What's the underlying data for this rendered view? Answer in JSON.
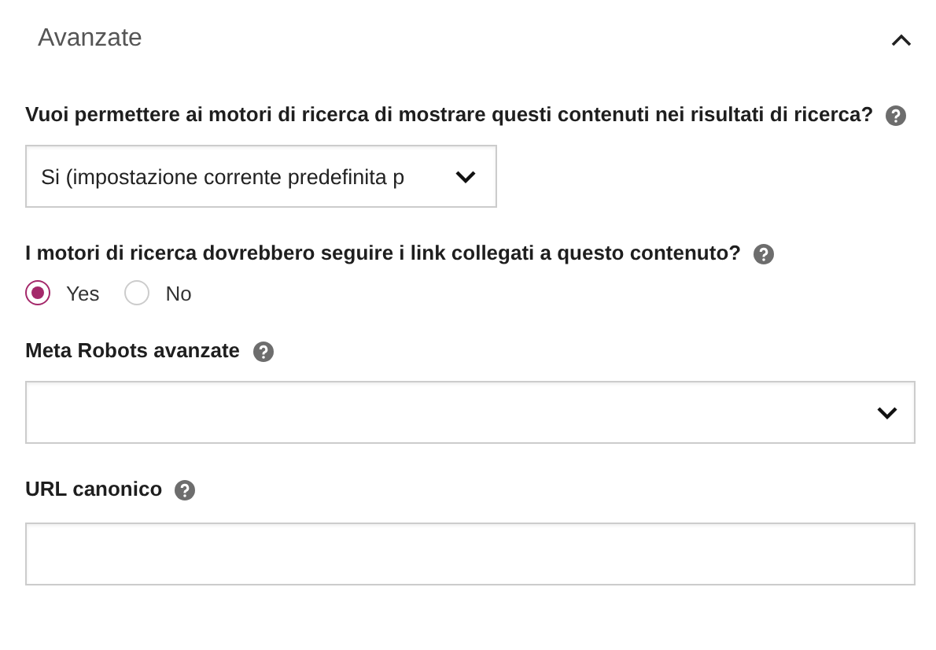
{
  "section": {
    "title": "Avanzate",
    "expanded": true
  },
  "fields": [
    {
      "kind": "select",
      "label": "Vuoi permettere ai motori di ricerca di mostrare questi contenuti nei risultati di ricerca?",
      "value": "Si (impostazione corrente predefinita p"
    },
    {
      "kind": "radio",
      "label": "I motori di ricerca dovrebbero seguire i link collegati a questo contenuto?",
      "options": [
        {
          "label": "Yes",
          "selected": true
        },
        {
          "label": "No",
          "selected": false
        }
      ]
    },
    {
      "kind": "select",
      "label": "Meta Robots avanzate"
    },
    {
      "kind": "text",
      "label": "URL canonico"
    }
  ]
}
